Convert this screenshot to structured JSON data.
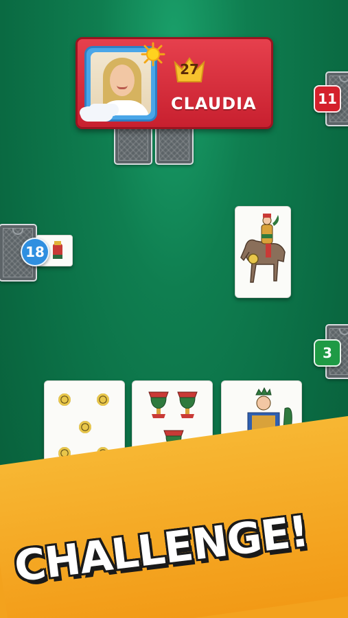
{
  "opponent": {
    "name": "CLAUDIA",
    "level": "27"
  },
  "counts": {
    "top_right": "11",
    "left": "18",
    "right": "3"
  },
  "banner": {
    "text": "CHALLENGE!"
  },
  "colors": {
    "table_green": "#0a6a42",
    "panel_red": "#d42a38",
    "badge_red": "#d4202c",
    "badge_blue": "#2f8fe0",
    "badge_green": "#1f9a45",
    "banner_orange": "#f29a16"
  },
  "icons": [
    "sun-icon",
    "crown-icon",
    "avatar",
    "card-back"
  ],
  "cards": {
    "played": "knight-of-coins",
    "hand": [
      "five-of-coins",
      "five-of-cups",
      "king-of-clubs"
    ]
  }
}
